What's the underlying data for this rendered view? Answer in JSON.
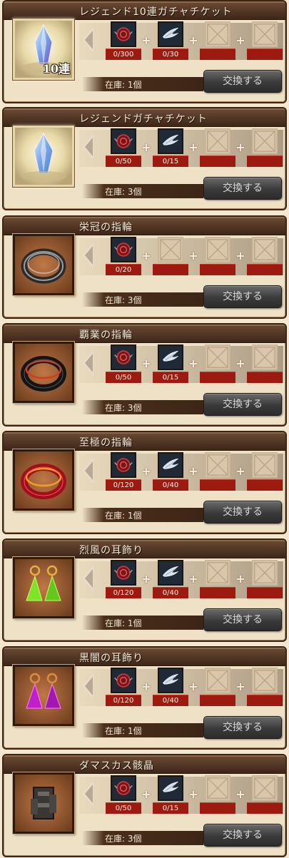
{
  "items": [
    {
      "title": "レジェンド10連ガチャチケット",
      "art": "ticket-10",
      "badge": "10連",
      "costs": [
        {
          "kind": "material",
          "icon": "seal-icon",
          "count": "0/300"
        },
        {
          "kind": "material",
          "icon": "wing-icon",
          "count": "0/30"
        },
        {
          "kind": "empty"
        },
        {
          "kind": "empty"
        }
      ],
      "stock": "在庫: 1個",
      "button": "交換する"
    },
    {
      "title": "レジェンドガチャチケット",
      "art": "ticket",
      "badge": "",
      "costs": [
        {
          "kind": "material",
          "icon": "seal-icon",
          "count": "0/50"
        },
        {
          "kind": "material",
          "icon": "wing-icon",
          "count": "0/15"
        },
        {
          "kind": "empty"
        },
        {
          "kind": "empty"
        }
      ],
      "stock": "在庫: 3個",
      "button": "交換する"
    },
    {
      "title": "栄冠の指輪",
      "art": "ring-silver",
      "badge": "",
      "costs": [
        {
          "kind": "material",
          "icon": "seal-icon",
          "count": "0/20"
        },
        {
          "kind": "empty"
        },
        {
          "kind": "empty"
        },
        {
          "kind": "empty"
        }
      ],
      "stock": "在庫: 3個",
      "button": "交換する"
    },
    {
      "title": "覇業の指輪",
      "art": "ring-black",
      "badge": "",
      "costs": [
        {
          "kind": "material",
          "icon": "seal-icon",
          "count": "0/50"
        },
        {
          "kind": "material",
          "icon": "wing-icon",
          "count": "0/15"
        },
        {
          "kind": "empty"
        },
        {
          "kind": "empty"
        }
      ],
      "stock": "在庫: 3個",
      "button": "交換する"
    },
    {
      "title": "至極の指輪",
      "art": "ring-red",
      "badge": "",
      "costs": [
        {
          "kind": "material",
          "icon": "seal-icon",
          "count": "0/120"
        },
        {
          "kind": "material",
          "icon": "wing-icon",
          "count": "0/40"
        },
        {
          "kind": "empty"
        },
        {
          "kind": "empty"
        }
      ],
      "stock": "在庫: 1個",
      "button": "交換する"
    },
    {
      "title": "烈風の耳飾り",
      "art": "earring-green",
      "badge": "",
      "costs": [
        {
          "kind": "material",
          "icon": "seal-icon",
          "count": "0/120"
        },
        {
          "kind": "material",
          "icon": "wing-icon",
          "count": "0/40"
        },
        {
          "kind": "empty"
        },
        {
          "kind": "empty"
        }
      ],
      "stock": "在庫: 1個",
      "button": "交換する"
    },
    {
      "title": "黒闇の耳飾り",
      "art": "earring-purple",
      "badge": "",
      "costs": [
        {
          "kind": "material",
          "icon": "seal-icon",
          "count": "0/120"
        },
        {
          "kind": "material",
          "icon": "wing-icon",
          "count": "0/40"
        },
        {
          "kind": "empty"
        },
        {
          "kind": "empty"
        }
      ],
      "stock": "在庫: 1個",
      "button": "交換する"
    },
    {
      "title": "ダマスカス骸晶",
      "art": "damascus",
      "badge": "",
      "costs": [
        {
          "kind": "material",
          "icon": "seal-icon",
          "count": "0/50"
        },
        {
          "kind": "material",
          "icon": "wing-icon",
          "count": "0/15"
        },
        {
          "kind": "empty"
        },
        {
          "kind": "empty"
        }
      ],
      "stock": "在庫: 3個",
      "button": "交換する"
    }
  ],
  "colors": {
    "count_bar": "#9c1a10",
    "header": "#4a2f1f",
    "background": "#f3e7cf"
  }
}
